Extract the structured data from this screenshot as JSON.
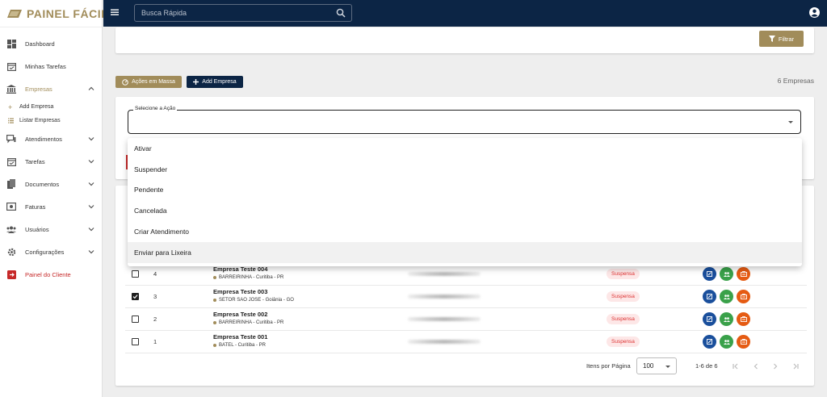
{
  "brand": {
    "name": "PAINEL FÁCIL"
  },
  "topbar": {
    "search_placeholder": "Busca Rápida"
  },
  "sidebar": {
    "items": [
      {
        "label": "Dashboard",
        "icon": "dashboard-icon"
      },
      {
        "label": "Minhas Tarefas",
        "icon": "calendar-check-icon"
      },
      {
        "label": "Empresas",
        "icon": "bank-icon",
        "expanded": true
      },
      {
        "label": "Atendimentos",
        "icon": "chat-icon"
      },
      {
        "label": "Tarefas",
        "icon": "calendar-check-icon"
      },
      {
        "label": "Documentos",
        "icon": "documents-icon"
      },
      {
        "label": "Faturas",
        "icon": "invoice-icon"
      },
      {
        "label": "Usuários",
        "icon": "users-icon"
      },
      {
        "label": "Configurações",
        "icon": "gear-icon"
      },
      {
        "label": "Painel do Cliente",
        "icon": "exit-icon"
      }
    ],
    "sub_items": [
      {
        "label": "Add Empresa",
        "icon": "plus-icon"
      },
      {
        "label": "Listar Empresas",
        "icon": "list-icon"
      }
    ]
  },
  "filter": {
    "button_label": "Filtrar"
  },
  "toolbar": {
    "bulk_actions_label": "Ações em Massa",
    "add_company_label": "Add Empresa",
    "count_label": "6 Empresas"
  },
  "action_select": {
    "label": "Selecione a Ação",
    "value": "",
    "options": [
      "Ativar",
      "Suspender",
      "Pendente",
      "Cancelada",
      "Criar Atendimento",
      "Enviar para Lixeira"
    ],
    "highlighted": "Enviar para Lixeira"
  },
  "table": {
    "rows": [
      {
        "id": "4",
        "name": "Empresa Teste 004",
        "location": "BARREIRINHA - Curitiba - PR",
        "status": "Suspensa",
        "checked": false
      },
      {
        "id": "3",
        "name": "Empresa Teste 003",
        "location": "SETOR SAO JOSE - Goiânia - GO",
        "status": "Suspensa",
        "checked": true
      },
      {
        "id": "2",
        "name": "Empresa Teste 002",
        "location": "BARREIRINHA - Curitiba - PR",
        "status": "Suspensa",
        "checked": false
      },
      {
        "id": "1",
        "name": "Empresa Teste 001",
        "location": "BATEL - Curitiba - PR",
        "status": "Suspensa",
        "checked": false
      }
    ]
  },
  "pagination": {
    "per_page_label": "Itens por Página",
    "per_page_value": "100",
    "range_label": "1-6 de 6"
  },
  "colors": {
    "navy": "#0c2545",
    "gold": "#a18c5a",
    "red": "#c62828"
  }
}
